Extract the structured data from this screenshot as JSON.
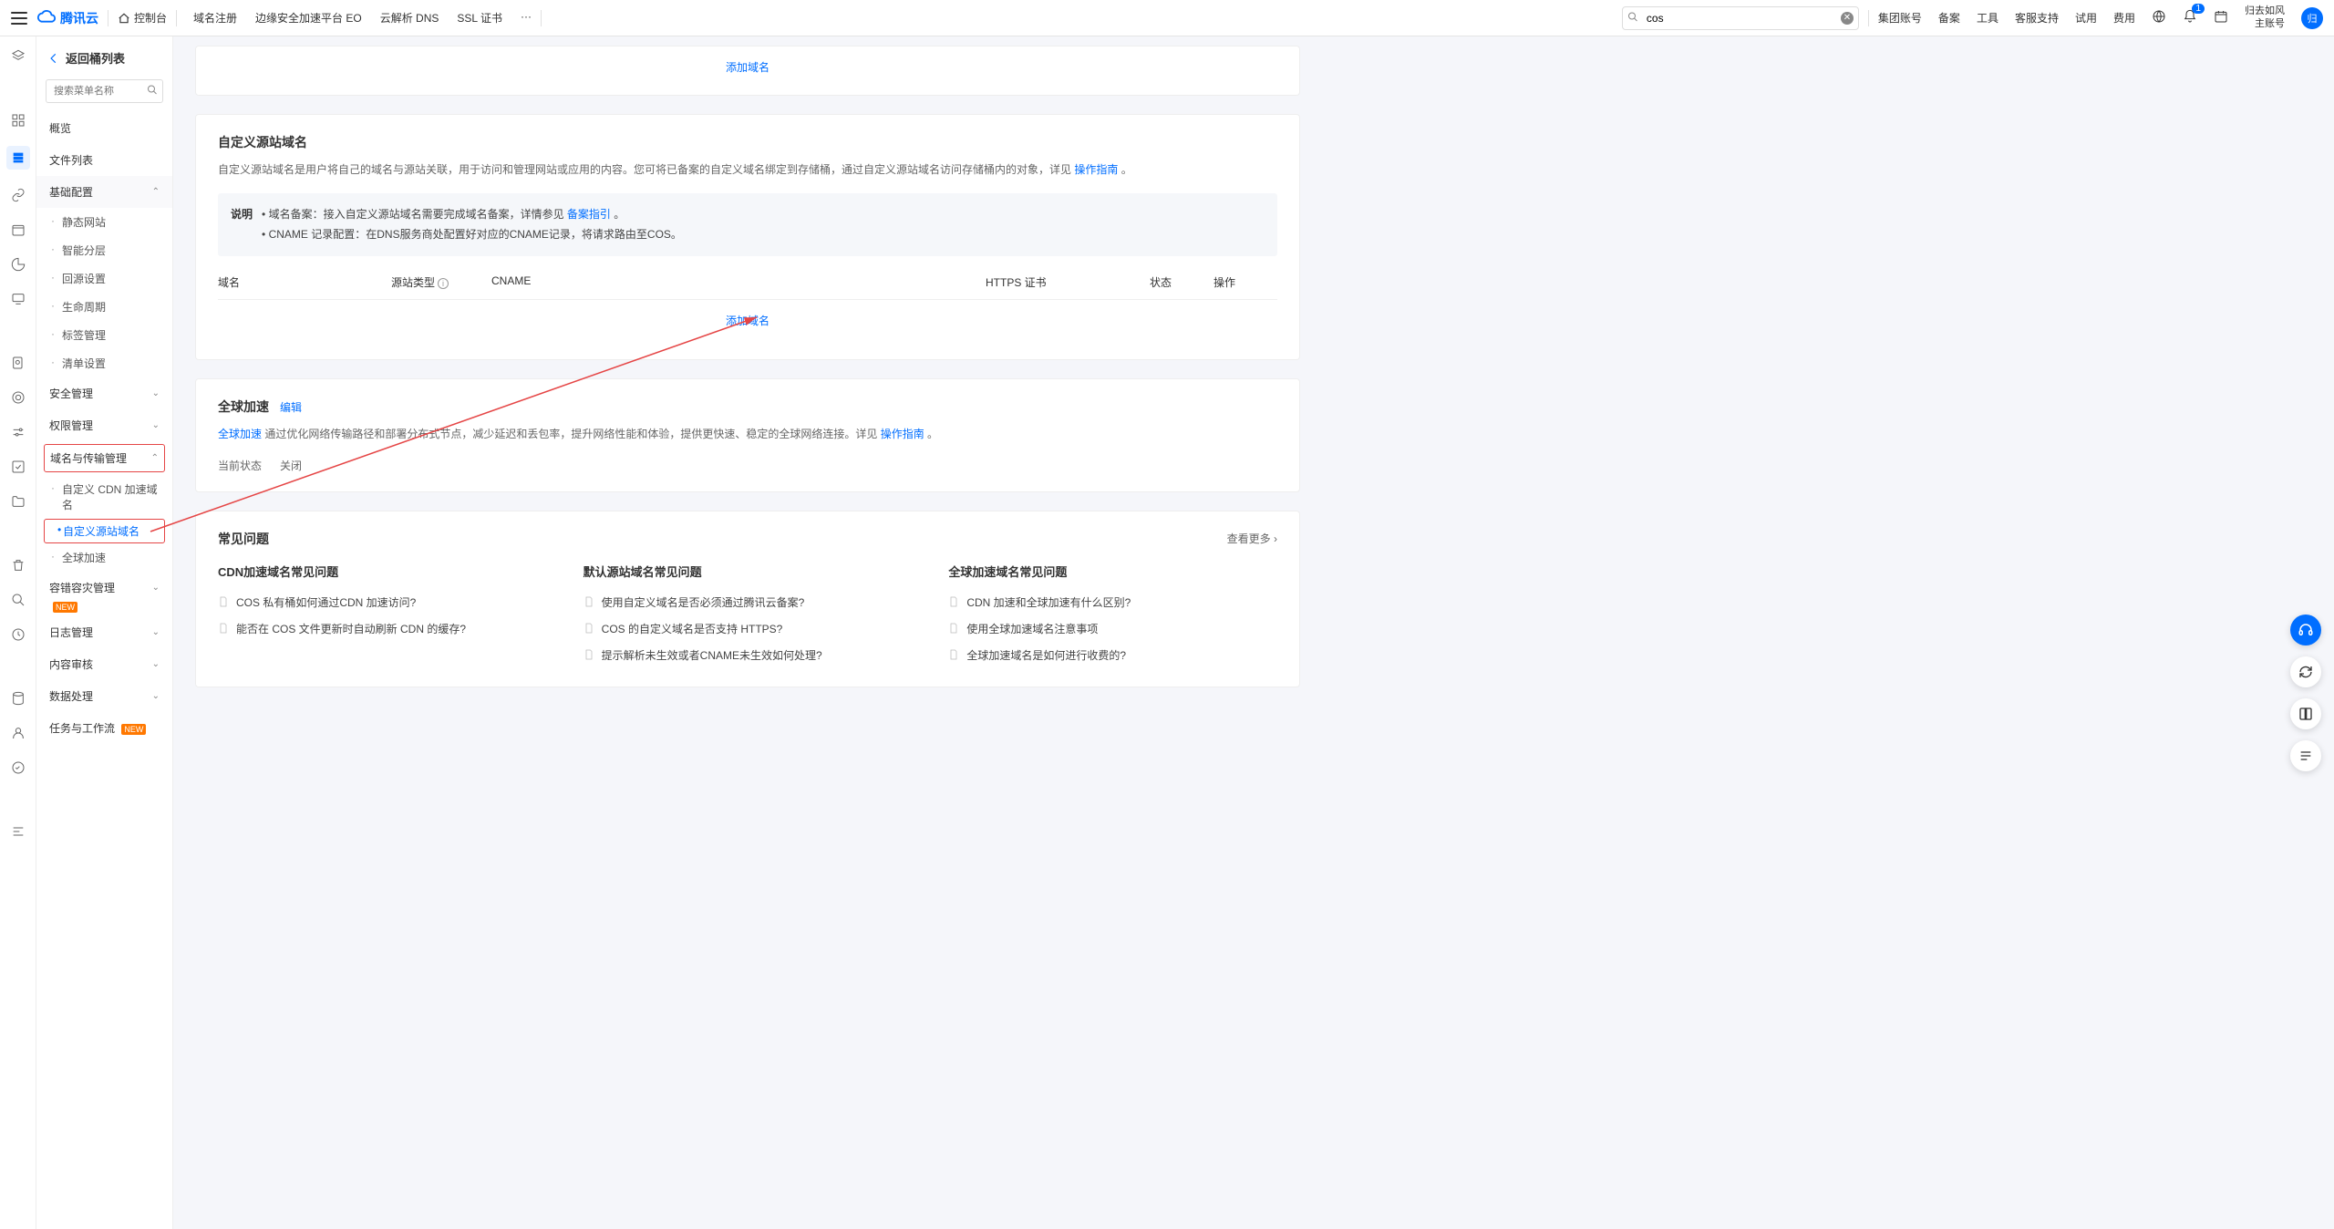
{
  "top": {
    "brand": "腾讯云",
    "console": "控制台",
    "nav": [
      "域名注册",
      "边缘安全加速平台 EO",
      "云解析 DNS",
      "SSL 证书",
      "···"
    ],
    "search_value": "cos",
    "right_links": [
      "集团账号",
      "备案",
      "工具",
      "客服支持",
      "试用",
      "费用"
    ],
    "user_name": "归去如风",
    "user_sub": "主账号",
    "avatar_text": "归",
    "bell_count": "1"
  },
  "sidebar": {
    "back": "返回桶列表",
    "search_placeholder": "搜索菜单名称",
    "items": {
      "overview": "概览",
      "filelist": "文件列表",
      "baseconf": "基础配置",
      "base_subs": [
        "静态网站",
        "智能分层",
        "回源设置",
        "生命周期",
        "标签管理",
        "清单设置"
      ],
      "security": "安全管理",
      "perm": "权限管理",
      "domain": "域名与传输管理",
      "domain_subs": [
        "自定义 CDN 加速域名",
        "自定义源站域名",
        "全球加速"
      ],
      "fault": "容错容灾管理",
      "new_badge": "NEW",
      "log": "日志管理",
      "audit": "内容审核",
      "dataproc": "数据处理",
      "workflow": "任务与工作流"
    }
  },
  "card_top": {
    "add": "添加域名"
  },
  "custom_origin": {
    "title": "自定义源站域名",
    "desc_1": "自定义源站域名是用户将自己的域名与源站关联，用于访问和管理网站或应用的内容。您可将已备案的自定义域名绑定到存储桶，通过自定义源站域名访问存储桶内的对象，详见 ",
    "desc_link": "操作指南",
    "note_label": "说明",
    "note_1a": "域名备案：接入自定义源站域名需要完成域名备案，详情参见 ",
    "note_1_link": "备案指引",
    "note_2": "CNAME 记录配置：在DNS服务商处配置好对应的CNAME记录，将请求路由至COS。",
    "th_domain": "域名",
    "th_origin": "源站类型",
    "th_cname": "CNAME",
    "th_https": "HTTPS 证书",
    "th_status": "状态",
    "th_ops": "操作",
    "add": "添加域名"
  },
  "global_accel": {
    "title": "全球加速",
    "edit": "编辑",
    "desc_link1": "全球加速",
    "desc_body": " 通过优化网络传输路径和部署分布式节点，减少延迟和丢包率，提升网络性能和体验，提供更快速、稳定的全球网络连接。详见 ",
    "desc_link2": "操作指南",
    "status_label": "当前状态",
    "status_value": "关闭"
  },
  "faq": {
    "title": "常见问题",
    "more": "查看更多",
    "cols": [
      {
        "head": "CDN加速域名常见问题",
        "items": [
          "COS 私有桶如何通过CDN 加速访问?",
          "能否在 COS 文件更新时自动刷新 CDN 的缓存?"
        ]
      },
      {
        "head": "默认源站域名常见问题",
        "items": [
          "使用自定义域名是否必须通过腾讯云备案?",
          "COS 的自定义域名是否支持 HTTPS?",
          "提示解析未生效或者CNAME未生效如何处理?"
        ]
      },
      {
        "head": "全球加速域名常见问题",
        "items": [
          "CDN 加速和全球加速有什么区别?",
          "使用全球加速域名注意事项",
          "全球加速域名是如何进行收费的?"
        ]
      }
    ]
  }
}
